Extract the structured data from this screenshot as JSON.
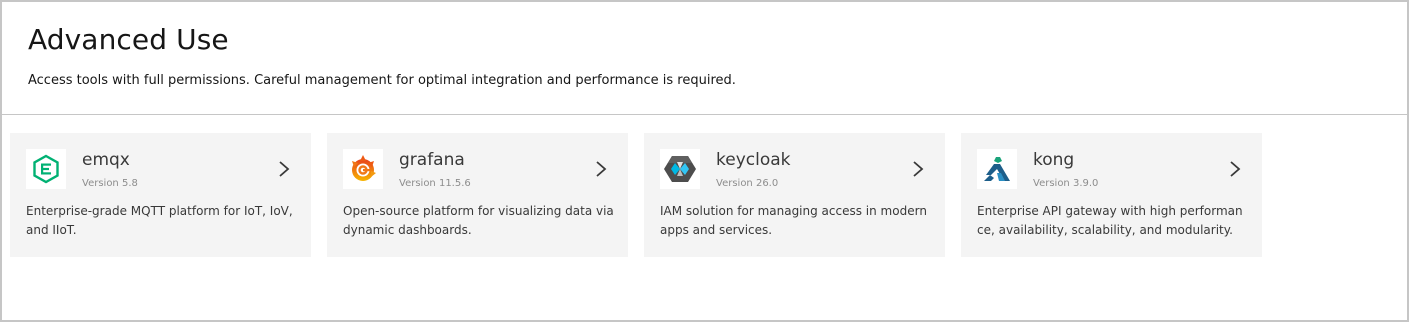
{
  "section": {
    "title": "Advanced Use",
    "subtitle": "Access tools with full permissions. Careful management for optimal integration and performance is required."
  },
  "cards": [
    {
      "name": "emqx",
      "version": "Version 5.8",
      "description": "Enterprise-grade MQTT platform for IoT, IoV, and IIoT.",
      "icon": "emqx-logo-icon",
      "color": "#00b173"
    },
    {
      "name": "grafana",
      "version": "Version 11.5.6",
      "description": "Open-source platform for visualizing data via dynamic dashboards.",
      "icon": "grafana-logo-icon",
      "color": "#f46800"
    },
    {
      "name": "keycloak",
      "version": "Version 26.0",
      "description": "IAM solution for managing access in modern apps and services.",
      "icon": "keycloak-logo-icon",
      "color": "#4d4d4d"
    },
    {
      "name": "kong",
      "version": "Version 3.9.0",
      "description": "Enterprise API gateway with high performance, availability, scalability, and modularity.",
      "icon": "kong-logo-icon",
      "color": "#1d5e8a"
    }
  ]
}
